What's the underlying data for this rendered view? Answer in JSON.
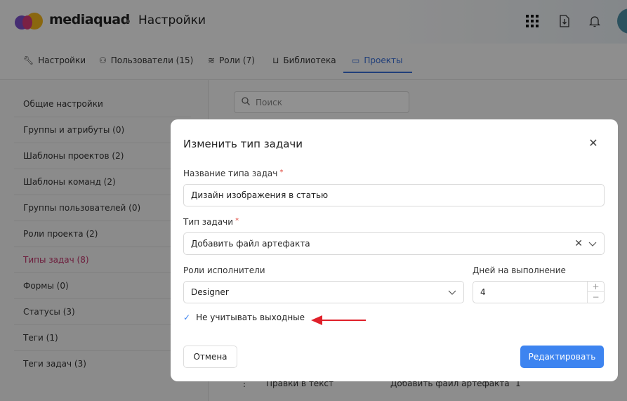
{
  "header": {
    "brand": "mediaquad",
    "title": "Настройки",
    "icons": [
      "apps-grid-icon",
      "download-file-icon",
      "bell-icon"
    ]
  },
  "tabs": [
    {
      "label": "Настройки",
      "icon": "wrench-icon"
    },
    {
      "label": "Пользователи (15)",
      "icon": "users-icon"
    },
    {
      "label": "Роли (7)",
      "icon": "layers-icon"
    },
    {
      "label": "Библиотека",
      "icon": "inbox-icon"
    },
    {
      "label": "Проекты",
      "icon": "window-icon",
      "active": true
    }
  ],
  "sidebar": {
    "items": [
      {
        "label": "Общие настройки"
      },
      {
        "label": "Группы и атрибуты (0)"
      },
      {
        "label": "Шаблоны проектов (2)"
      },
      {
        "label": "Шаблоны команд (2)"
      },
      {
        "label": "Группы пользователей (0)"
      },
      {
        "label": "Роли проекта (2)"
      },
      {
        "label": "Типы задач (8)",
        "active": true
      },
      {
        "label": "Формы (0)"
      },
      {
        "label": "Статусы (3)"
      },
      {
        "label": "Теги (1)"
      },
      {
        "label": "Теги задач (3)"
      }
    ]
  },
  "main": {
    "search_placeholder": "Поиск",
    "bottom_row": {
      "name": "Правки в текст",
      "type": "Добавить файл артефакта",
      "count": "1"
    }
  },
  "modal": {
    "title": "Изменить тип задачи",
    "name_label": "Название типа задач",
    "name_value": "Дизайн изображения в статью",
    "type_label": "Тип задачи",
    "type_value": "Добавить файл артефакта",
    "roles_label": "Роли исполнители",
    "roles_value": "Designer",
    "days_label": "Дней на выполнение",
    "days_value": "4",
    "weekend_label": "Не учитывать выходные",
    "weekend_checked": true,
    "cancel": "Отмена",
    "submit": "Редактировать"
  },
  "colors": {
    "accent": "#3d84f0",
    "active_tab": "#3b6fd6",
    "active_sidebar": "#c0336a",
    "required": "#e0453a",
    "annotation_arrow": "#e0202a"
  }
}
